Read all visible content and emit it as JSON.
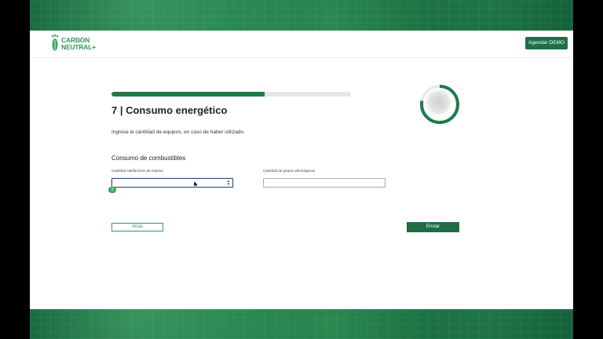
{
  "header": {
    "logo_line1": "CARBON",
    "logo_line2": "NEUTRAL+",
    "demo_button": "Agendar DEMO"
  },
  "progress": {
    "fraction": 0.64
  },
  "step": {
    "title": "7 | Consumo energético",
    "instruction": "Ingrese la cantidad de equipos, en caso de haber utilizado."
  },
  "section": {
    "title": "Consumo de combustibles",
    "fields": [
      {
        "label": "Cantidad calefactores de exterior",
        "value": ""
      },
      {
        "label": "Cantidad de grupos electrógenos",
        "value": ""
      }
    ],
    "counter_badge": "0"
  },
  "actions": {
    "back": "Atras",
    "send": "Enviar"
  },
  "gauge": {
    "fraction": 0.78
  },
  "colors": {
    "brand_green": "#1e6f45",
    "accent_green": "#2f9a5a"
  },
  "icons": [
    "footprint-logo-icon",
    "spinner-arrows-icon",
    "mouse-cursor-icon"
  ]
}
